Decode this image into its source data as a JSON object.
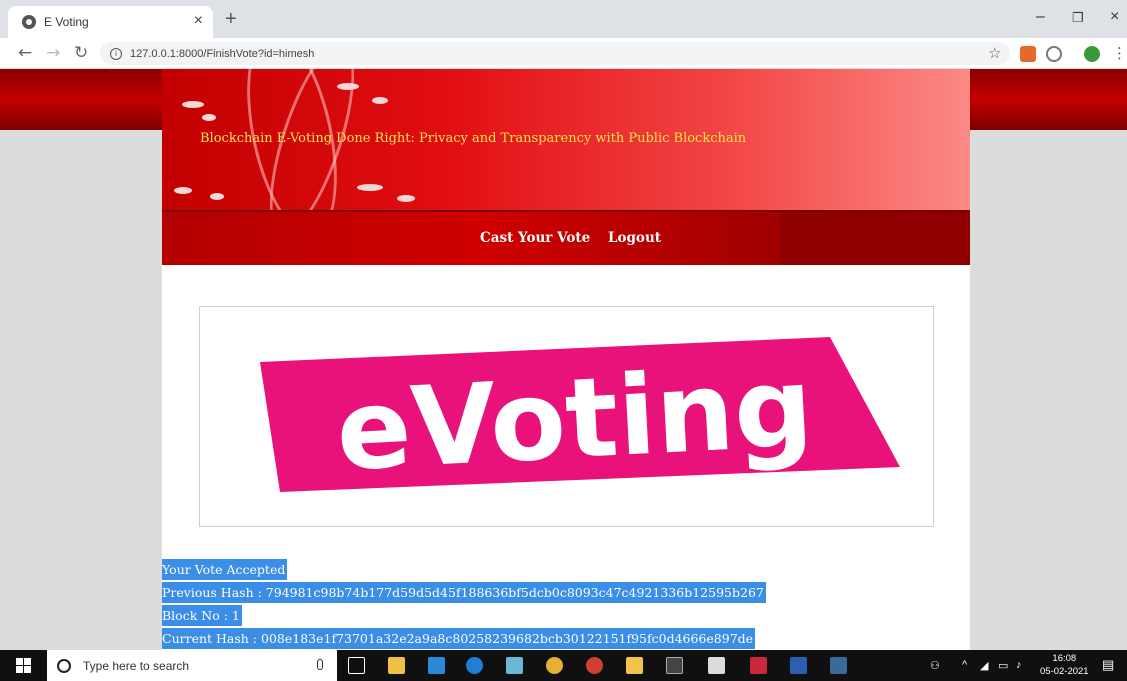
{
  "browser": {
    "tab_title": "E Voting",
    "tab_close": "×",
    "new_tab": "+",
    "url": "127.0.0.1:8000/FinishVote?id=himesh",
    "window_minimize": "–",
    "window_restore": "❐",
    "window_close": "×"
  },
  "header": {
    "title": "Blockchain E-Voting Done Right: Privacy and Transparency with Public Blockchain"
  },
  "nav": {
    "items": [
      {
        "label": "Cast Your Vote"
      },
      {
        "label": "Logout"
      }
    ]
  },
  "logo": {
    "text": "eVoting",
    "color": "#e8127a"
  },
  "result": {
    "status": "Your Vote Accepted",
    "previous_hash": "Previous Hash : 794981c98b74b177d59d5d45f188636bf5dcb0c8093c47c4921336b12595b267",
    "block_no": "Block No : 1",
    "current_hash": "Current Hash : 008e183e1f73701a32e2a9a8c80258239682bcb30122151f95fc0d4666e897de"
  },
  "taskbar": {
    "search_placeholder": "Type here to search",
    "time": "16:08",
    "date": "05-02-2021"
  },
  "colors": {
    "accent_red": "#d40000",
    "title_yellow": "#ffe24a",
    "selection_blue": "#3a8ee6"
  }
}
